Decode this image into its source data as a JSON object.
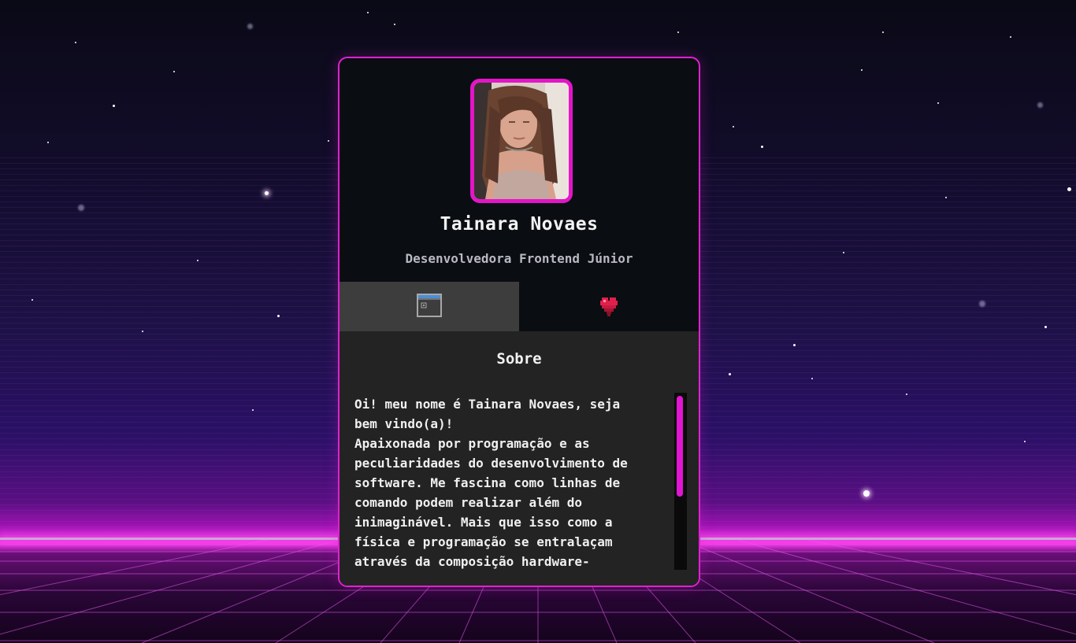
{
  "profile": {
    "name": "Tainara Novaes",
    "role": "Desenvolvedora Frontend Júnior",
    "avatar_icon": "profile-photo"
  },
  "tabs": [
    {
      "icon": "window-icon",
      "active": true
    },
    {
      "icon": "heart-icon",
      "active": false
    }
  ],
  "about": {
    "title": "Sobre",
    "text": "Oi! meu nome é Tainara Novaes, seja\nbem vindo(a)!\nApaixonada por programação e as\npeculiaridades do desenvolvimento de\nsoftware. Me fascina como linhas de\ncomando podem realizar além do\ninimaginável. Mais que isso como a\nfísica e programação se entralaçam\natravés da composição hardware-"
  },
  "colors": {
    "accent": "#e021d0",
    "card_background": "#0a0d12",
    "panel_background": "#232323",
    "active_tab": "#3d3d3d"
  }
}
